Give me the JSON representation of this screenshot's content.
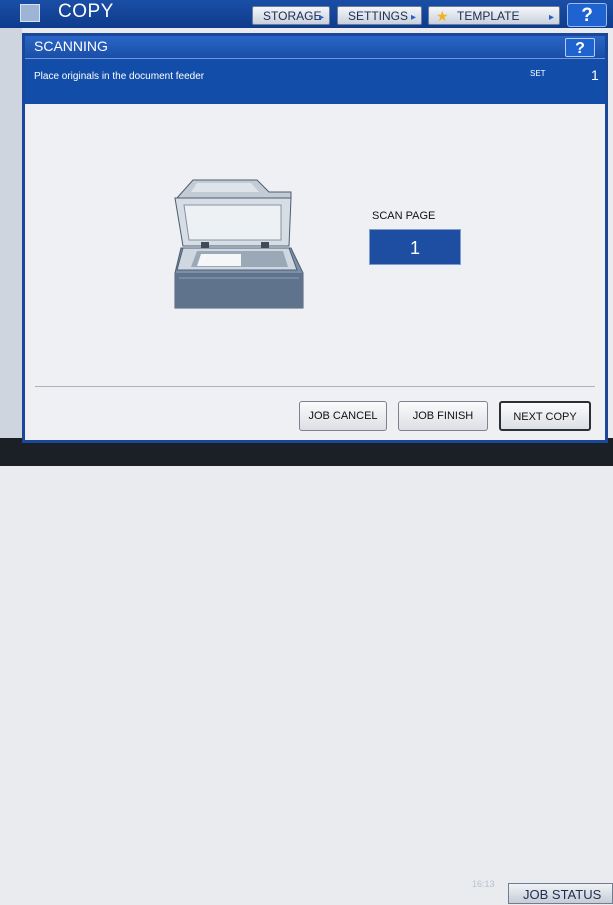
{
  "topbar": {
    "app_title": "COPY",
    "buttons": [
      "STORAGE",
      "SETTINGS",
      "TEMPLATE"
    ],
    "help_label": "?"
  },
  "dialog": {
    "title": "SCANNING",
    "help_label": "?",
    "message": "Place originals in the document feeder",
    "set_label": "SET",
    "set_value": "1",
    "scan_page_label": "SCAN PAGE",
    "scan_page_value": "1",
    "buttons": {
      "job_cancel": "JOB CANCEL",
      "job_finish": "JOB FINISH",
      "next_copy": "NEXT COPY"
    }
  },
  "footer": {
    "time": "16:13",
    "job_status": "JOB STATUS"
  },
  "colors": {
    "title_blue": "#1a4ea6",
    "message_bar": "#124ea9",
    "scan_box": "#1d4ea2"
  },
  "icons": [
    "copy-app-icon",
    "star-icon",
    "scanner-illustration"
  ]
}
